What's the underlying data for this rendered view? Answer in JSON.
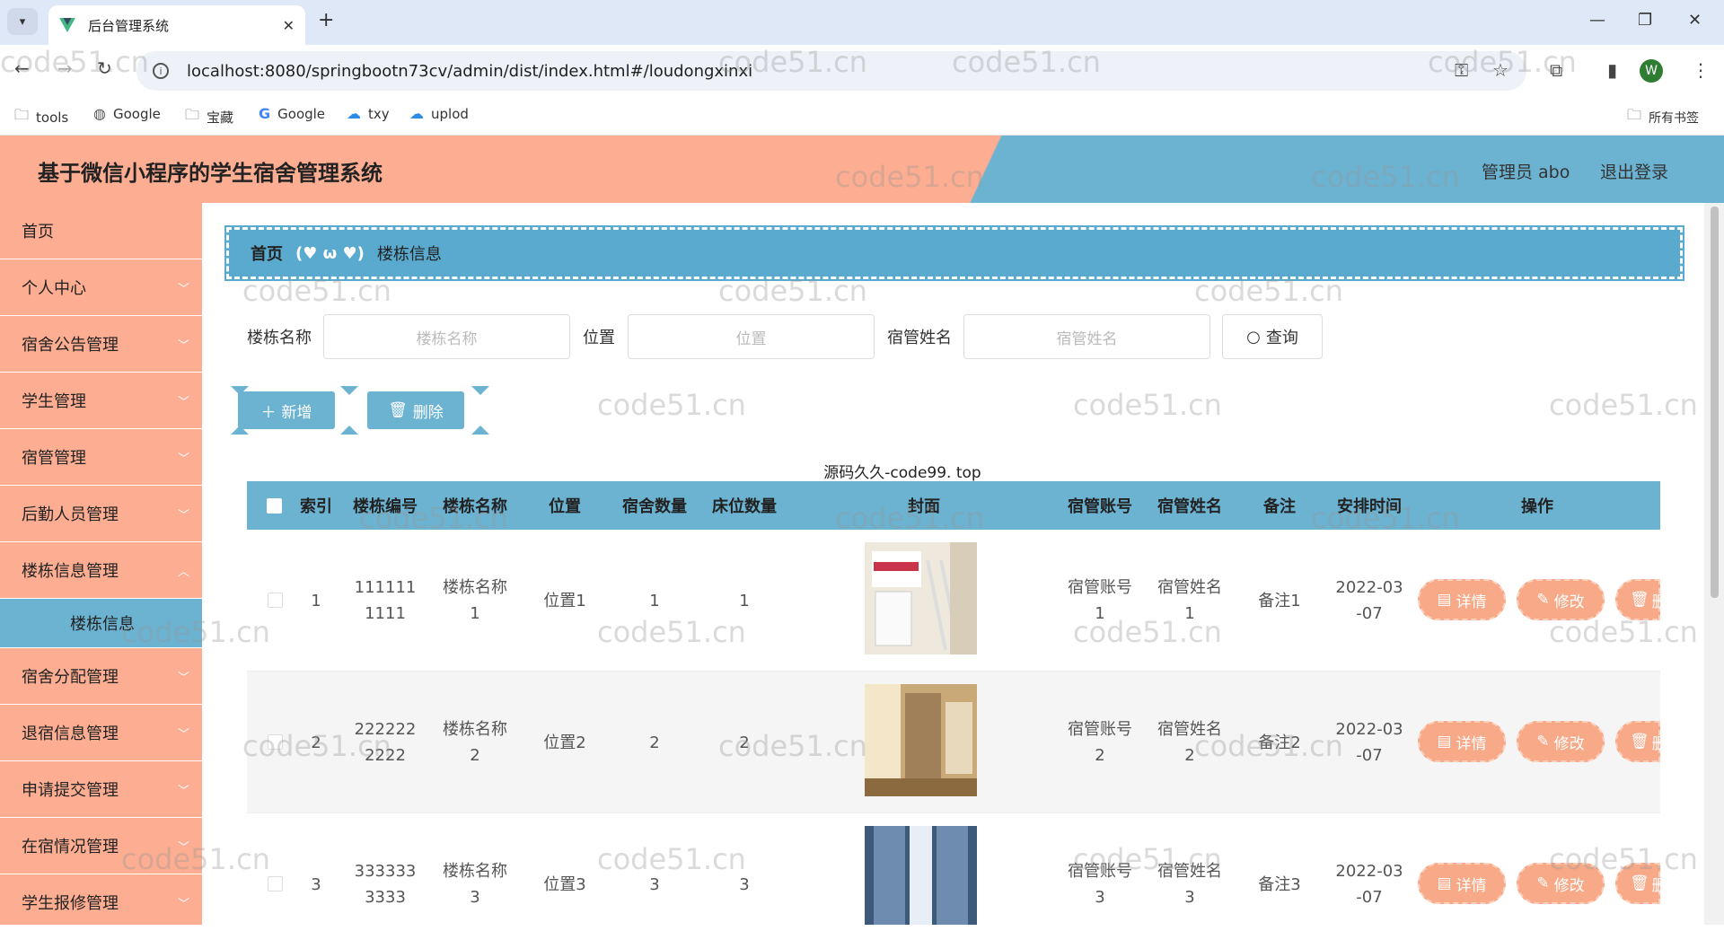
{
  "browser": {
    "tab_title": "后台管理系统",
    "url": "localhost:8080/springbootn73cv/admin/dist/index.html#/loudongxinxi",
    "bookmarks": [
      "tools",
      "Google",
      "宝藏",
      "Google",
      "txy",
      "uplod"
    ],
    "all_bookmarks": "所有书签",
    "profile_initial": "W"
  },
  "app": {
    "title": "基于微信小程序的学生宿舍管理系统",
    "admin_label": "管理员 abo",
    "logout": "退出登录"
  },
  "sidebar": {
    "items": [
      {
        "label": "首页",
        "chevron": false
      },
      {
        "label": "个人中心",
        "chevron": true
      },
      {
        "label": "宿舍公告管理",
        "chevron": true
      },
      {
        "label": "学生管理",
        "chevron": true
      },
      {
        "label": "宿管管理",
        "chevron": true
      },
      {
        "label": "后勤人员管理",
        "chevron": true
      },
      {
        "label": "楼栋信息管理",
        "chevron": true
      }
    ],
    "active_sub": "楼栋信息",
    "items_after": [
      {
        "label": "宿舍分配管理"
      },
      {
        "label": "退宿信息管理"
      },
      {
        "label": "申请提交管理"
      },
      {
        "label": "在宿情况管理"
      },
      {
        "label": "学生报修管理"
      }
    ]
  },
  "breadcrumb": {
    "home": "首页",
    "separator": "(♥ ω ♥)",
    "current": "楼栋信息"
  },
  "search": {
    "name_label": "楼栋名称",
    "name_placeholder": "楼栋名称",
    "pos_label": "位置",
    "pos_placeholder": "位置",
    "mgr_label": "宿管姓名",
    "mgr_placeholder": "宿管姓名",
    "query_btn": "查询"
  },
  "actions": {
    "add": "新增",
    "delete": "删除"
  },
  "table": {
    "caption": "源码久久-code99. top",
    "headers": [
      "索引",
      "楼栋编号",
      "楼栋名称",
      "位置",
      "宿舍数量",
      "床位数量",
      "封面",
      "宿管账号",
      "宿管姓名",
      "备注",
      "安排时间",
      "操作"
    ],
    "rows": [
      {
        "idx": "1",
        "code": "1111111111",
        "name": "楼栋名称1",
        "pos": "位置1",
        "dorms": "1",
        "beds": "1",
        "account": "宿管账号1",
        "mgr": "宿管姓名1",
        "note": "备注1",
        "time": "2022-03-07"
      },
      {
        "idx": "2",
        "code": "2222222222",
        "name": "楼栋名称2",
        "pos": "位置2",
        "dorms": "2",
        "beds": "2",
        "account": "宿管账号2",
        "mgr": "宿管姓名2",
        "note": "备注2",
        "time": "2022-03-07"
      },
      {
        "idx": "3",
        "code": "3333333333",
        "name": "楼栋名称3",
        "pos": "位置3",
        "dorms": "3",
        "beds": "3",
        "account": "宿管账号3",
        "mgr": "宿管姓名3",
        "note": "备注3",
        "time": "2022-03-07"
      }
    ],
    "op_detail": "详情",
    "op_edit": "修改",
    "op_delete": "删"
  },
  "watermark_text": "code51.cn"
}
